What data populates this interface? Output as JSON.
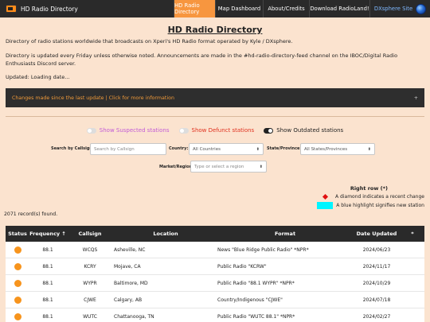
{
  "nav": {
    "brand": "HD Radio Directory",
    "items": [
      {
        "label": "HD Radio Directory",
        "active": true
      },
      {
        "label": "Map Dashboard",
        "active": false
      },
      {
        "label": "About/Credits",
        "active": false
      },
      {
        "label": "Download RadioLand!",
        "active": false
      }
    ],
    "dx_label": "DXsphere Site"
  },
  "page": {
    "title": "HD Radio Directory",
    "desc1": "Directory of radio stations worldwide that broadcasts on Xperi's HD Radio format operated by Kyle / DXsphere.",
    "desc2": "Directory is updated every Friday unless otherwise noted. Announcements are made in the #hd-radio-directory-feed channel on the IBOC/Digital Radio Enthusiasts Discord server.",
    "updated": "Updated: Loading date..."
  },
  "changes": {
    "text": "Changes made since the last update | Click for more information",
    "toggle_symbol": "+"
  },
  "toggles": {
    "suspected": "Show Suspected stations",
    "defunct": "Show Defunct stations",
    "outdated": "Show Outdated stations"
  },
  "filters": {
    "callsign_label": "Search by Callsign:",
    "callsign_placeholder": "Search by Callsign",
    "country_label": "Country:",
    "country_value": "All Countries",
    "state_label": "State/Province:",
    "state_value": "All States/Provinces",
    "market_label": "Market/Region:",
    "market_value": "Type or select a region"
  },
  "legend": {
    "title": "Right row (*)",
    "diamond_text": "A diamond indicates a recent change",
    "highlight_text": "A blue highlight signifies new station",
    "colors": {
      "diamond": "#e01010",
      "highlight": "#00f5ff"
    }
  },
  "records": "2071 record(s) found.",
  "table": {
    "headers": {
      "status": "Status",
      "frequency": "Frequency ↑",
      "callsign": "Callsign",
      "location": "Location",
      "format": "Format",
      "date": "Date Updated",
      "star": "*"
    },
    "rows": [
      {
        "freq": "88.1",
        "call": "WCQS",
        "loc": "Asheville, NC",
        "fmt": "News \"Blue Ridge Public Radio\" *NPR*",
        "date": "2024/06/23"
      },
      {
        "freq": "88.1",
        "call": "KCRY",
        "loc": "Mojave, CA",
        "fmt": "Public Radio \"KCRW\"",
        "date": "2024/11/17"
      },
      {
        "freq": "88.1",
        "call": "WYPR",
        "loc": "Baltimore, MD",
        "fmt": "Public Radio \"88.1 WYPR\" *NPR*",
        "date": "2024/10/29"
      },
      {
        "freq": "88.1",
        "call": "CJWE",
        "loc": "Calgary, AB",
        "fmt": "Country/Indigenous \"CJWE\"",
        "date": "2024/07/18"
      },
      {
        "freq": "88.1",
        "call": "WUTC",
        "loc": "Chattanooga, TN",
        "fmt": "Public Radio \"WUTC 88.1\" *NPR*",
        "date": "2024/02/27"
      }
    ],
    "status_color": "#f7941d"
  }
}
